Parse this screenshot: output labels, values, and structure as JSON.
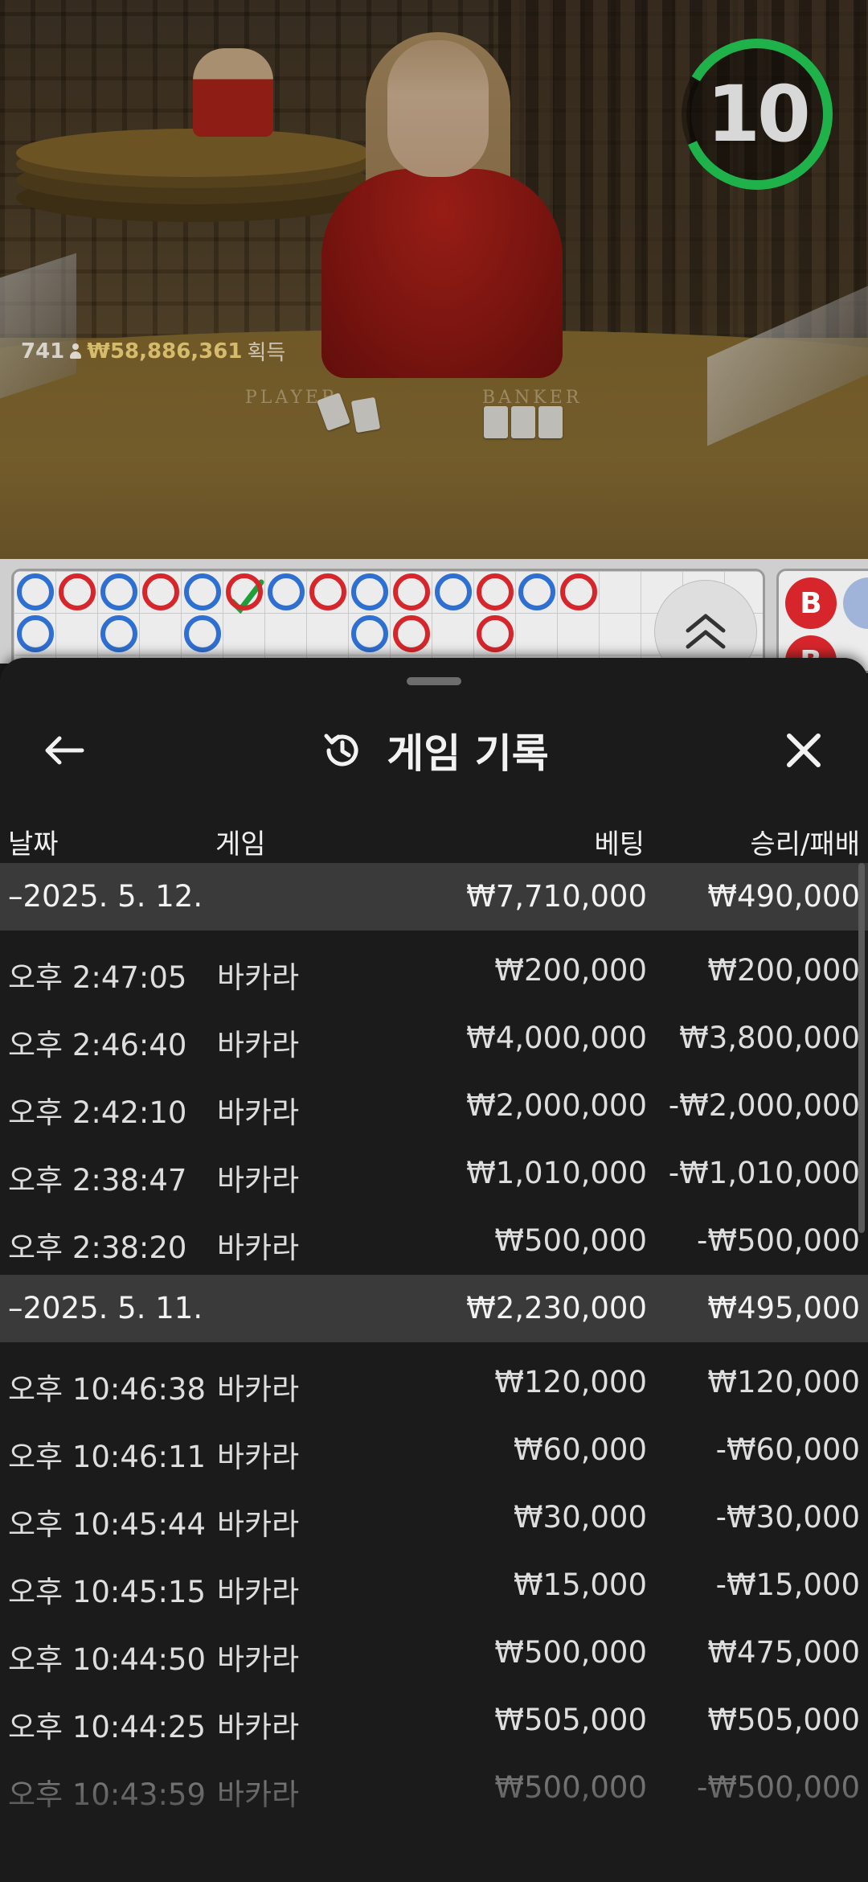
{
  "video": {
    "players_count": "741",
    "total_won": "₩58,886,361",
    "won_suffix": "획득",
    "table_label_player": "PLAYER",
    "table_label_banker": "BANKER",
    "countdown": "10",
    "countdown_color": "#1fb24a"
  },
  "roadmap": {
    "top_row": [
      "P",
      "B",
      "P",
      "B",
      "P",
      "B",
      "P",
      "B",
      "P",
      "B",
      "P",
      "B",
      "P",
      "B"
    ],
    "second_row": [
      "P",
      "",
      "P",
      "",
      "P",
      "",
      "",
      "",
      "P",
      "B",
      "",
      "B",
      "",
      ""
    ],
    "side_chips": [
      "B",
      "B"
    ]
  },
  "sheet": {
    "title": "게임 기록",
    "columns": {
      "date": "날짜",
      "game": "게임",
      "bet": "베팅",
      "result": "승리/패배"
    },
    "groups": [
      {
        "date": "–2025. 5. 12.",
        "bet_total": "₩7,710,000",
        "result_total": "₩490,000",
        "rows": [
          {
            "time": "오후 2:47:05",
            "game": "바카라",
            "bet": "₩200,000",
            "result": "₩200,000"
          },
          {
            "time": "오후 2:46:40",
            "game": "바카라",
            "bet": "₩4,000,000",
            "result": "₩3,800,000"
          },
          {
            "time": "오후 2:42:10",
            "game": "바카라",
            "bet": "₩2,000,000",
            "result": "-₩2,000,000"
          },
          {
            "time": "오후 2:38:47",
            "game": "바카라",
            "bet": "₩1,010,000",
            "result": "-₩1,010,000"
          },
          {
            "time": "오후 2:38:20",
            "game": "바카라",
            "bet": "₩500,000",
            "result": "-₩500,000"
          }
        ]
      },
      {
        "date": "–2025. 5. 11.",
        "bet_total": "₩2,230,000",
        "result_total": "₩495,000",
        "rows": [
          {
            "time": "오후 10:46:38",
            "game": "바카라",
            "bet": "₩120,000",
            "result": "₩120,000"
          },
          {
            "time": "오후 10:46:11",
            "game": "바카라",
            "bet": "₩60,000",
            "result": "-₩60,000"
          },
          {
            "time": "오후 10:45:44",
            "game": "바카라",
            "bet": "₩30,000",
            "result": "-₩30,000"
          },
          {
            "time": "오후 10:45:15",
            "game": "바카라",
            "bet": "₩15,000",
            "result": "-₩15,000"
          },
          {
            "time": "오후 10:44:50",
            "game": "바카라",
            "bet": "₩500,000",
            "result": "₩475,000"
          },
          {
            "time": "오후 10:44:25",
            "game": "바카라",
            "bet": "₩505,000",
            "result": "₩505,000"
          },
          {
            "time": "오후 10:43:59",
            "game": "바카라",
            "bet": "₩500,000",
            "result": "-₩500,000"
          }
        ]
      }
    ],
    "icons": {
      "back": "arrow-left-icon",
      "history": "history-icon",
      "close": "close-icon"
    }
  },
  "colors": {
    "player": "#2f6fd1",
    "banker": "#d6262b",
    "sheet_bg": "#1b1b1b",
    "group_bg": "#3a3a3a"
  }
}
